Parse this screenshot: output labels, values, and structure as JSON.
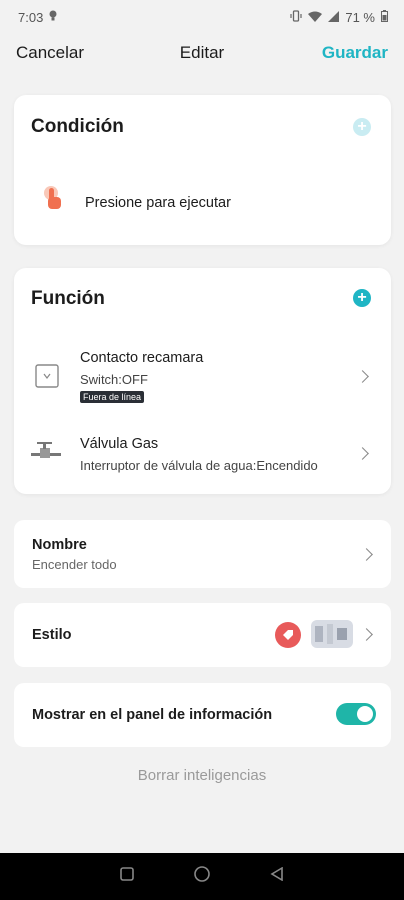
{
  "status_bar": {
    "time": "7:03",
    "battery": "71 %"
  },
  "header": {
    "cancel": "Cancelar",
    "title": "Editar",
    "save": "Guardar"
  },
  "condition": {
    "title": "Condición",
    "item_label": "Presione para ejecutar",
    "accent_color": "#f07050",
    "add_color": "#c9ecf2"
  },
  "function": {
    "title": "Función",
    "add_color": "#1fb5c4",
    "items": [
      {
        "name": "Contacto recamara",
        "detail": "Switch:OFF",
        "badge": "Fuera de línea",
        "icon": "switch-icon"
      },
      {
        "name": "Válvula Gas",
        "detail": "Interruptor de válvula de agua:Encendido",
        "icon": "valve-icon"
      }
    ]
  },
  "name_row": {
    "label": "Nombre",
    "value": "Encender todo"
  },
  "style_row": {
    "label": "Estilo",
    "icon_color": "#e85a5a"
  },
  "panel_row": {
    "label": "Mostrar en el panel de información",
    "toggle_on": true,
    "toggle_color": "#1fb5a8"
  },
  "delete_label": "Borrar inteligencias"
}
